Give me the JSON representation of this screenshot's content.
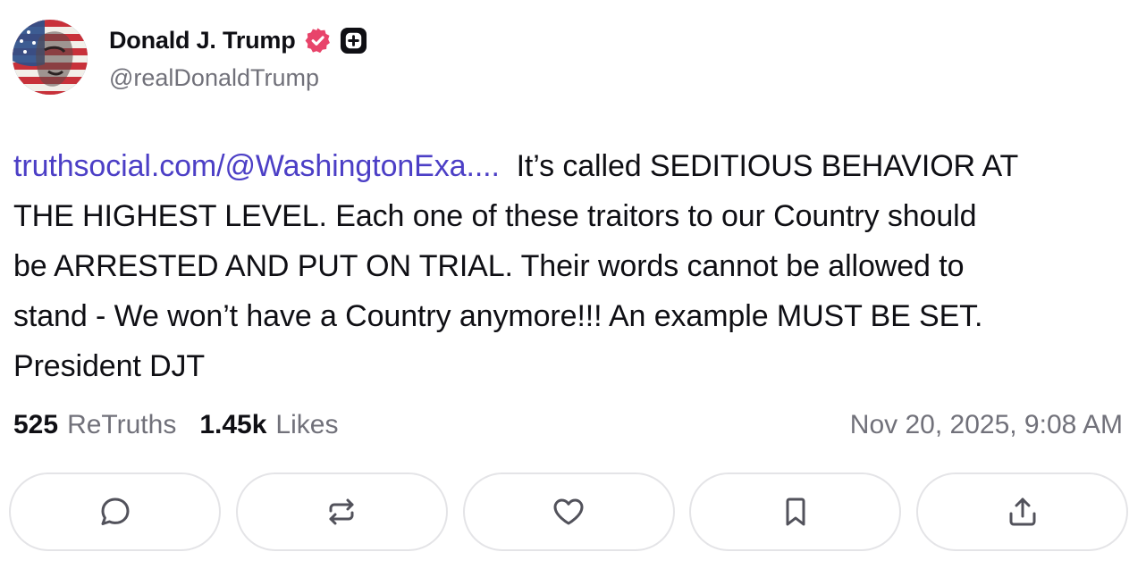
{
  "author": {
    "display_name": "Donald J. Trump",
    "handle": "@realDonaldTrump",
    "verified": true,
    "verified_color": "#e8446a",
    "plus_badge": true
  },
  "post": {
    "link_text": "truthsocial.com/@WashingtonExa....",
    "text_lines": [
      "It’s called SEDITIOUS BEHAVIOR AT",
      "THE HIGHEST LEVEL. Each one of these traitors to our Country should",
      "be ARRESTED AND PUT ON TRIAL. Their words cannot be allowed to",
      "stand - We won’t have a Country anymore!!! An example MUST BE SET.",
      "President DJT"
    ],
    "link_color": "#4c3fc6"
  },
  "stats": {
    "retruths_count": "525",
    "retruths_label": "ReTruths",
    "likes_count": "1.45k",
    "likes_label": "Likes",
    "timestamp": "Nov 20, 2025, 9:08 AM"
  },
  "actions": [
    {
      "name": "reply",
      "icon": "reply-icon"
    },
    {
      "name": "retruth",
      "icon": "retruth-icon"
    },
    {
      "name": "like",
      "icon": "heart-icon"
    },
    {
      "name": "bookmark",
      "icon": "bookmark-icon"
    },
    {
      "name": "share",
      "icon": "share-icon"
    }
  ]
}
